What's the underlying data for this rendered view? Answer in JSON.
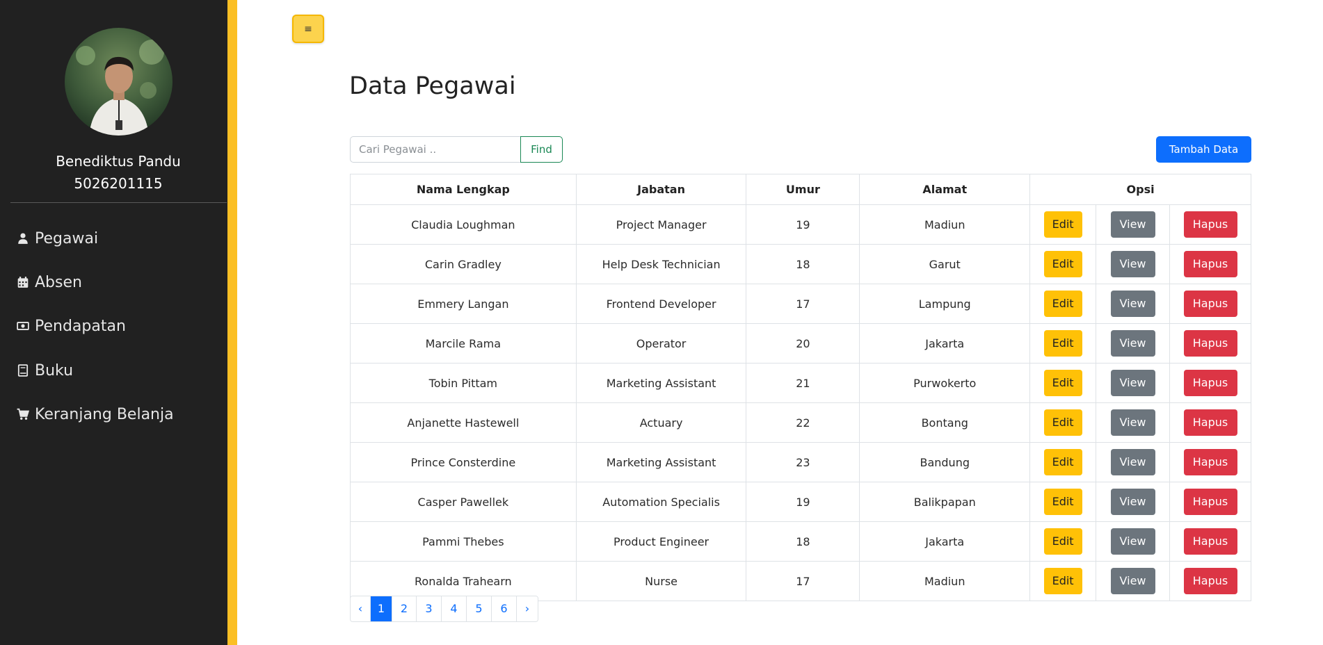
{
  "sidebar": {
    "profile": {
      "name": "Benediktus Pandu",
      "id": "5026201115"
    },
    "items": [
      {
        "label": "Pegawai",
        "icon": "person-icon"
      },
      {
        "label": "Absen",
        "icon": "calendar-icon"
      },
      {
        "label": "Pendapatan",
        "icon": "money-icon"
      },
      {
        "label": "Buku",
        "icon": "book-icon"
      },
      {
        "label": "Keranjang Belanja",
        "icon": "cart-icon"
      }
    ],
    "accent_color": "#fbbf24"
  },
  "header": {
    "menu_glyph": "≡"
  },
  "page": {
    "title": "Data Pegawai"
  },
  "search": {
    "placeholder": "Cari Pegawai ..",
    "value": "",
    "button_label": "Find"
  },
  "actions": {
    "add_label": "Tambah Data"
  },
  "table": {
    "columns": [
      "Nama Lengkap",
      "Jabatan",
      "Umur",
      "Alamat",
      "Opsi"
    ],
    "rows": [
      {
        "nama": "Claudia Loughman",
        "jabatan": "Project Manager",
        "umur": "19",
        "alamat": "Madiun"
      },
      {
        "nama": "Carin Gradley",
        "jabatan": "Help Desk Technician",
        "umur": "18",
        "alamat": "Garut"
      },
      {
        "nama": "Emmery Langan",
        "jabatan": "Frontend Developer",
        "umur": "17",
        "alamat": "Lampung"
      },
      {
        "nama": "Marcile Rama",
        "jabatan": "Operator",
        "umur": "20",
        "alamat": "Jakarta"
      },
      {
        "nama": "Tobin Pittam",
        "jabatan": "Marketing Assistant",
        "umur": "21",
        "alamat": "Purwokerto"
      },
      {
        "nama": "Anjanette Hastewell",
        "jabatan": "Actuary",
        "umur": "22",
        "alamat": "Bontang"
      },
      {
        "nama": "Prince Consterdine",
        "jabatan": "Marketing Assistant",
        "umur": "23",
        "alamat": "Bandung"
      },
      {
        "nama": "Casper Pawellek",
        "jabatan": "Automation Specialis",
        "umur": "19",
        "alamat": "Balikpapan"
      },
      {
        "nama": "Pammi Thebes",
        "jabatan": "Product Engineer",
        "umur": "18",
        "alamat": "Jakarta"
      },
      {
        "nama": "Ronalda Trahearn",
        "jabatan": "Nurse",
        "umur": "17",
        "alamat": "Madiun"
      }
    ],
    "row_actions": {
      "edit": "Edit",
      "view": "View",
      "delete": "Hapus"
    }
  },
  "pagination": {
    "prev": "‹",
    "next": "›",
    "pages": [
      "1",
      "2",
      "3",
      "4",
      "5",
      "6"
    ],
    "current": "1"
  }
}
